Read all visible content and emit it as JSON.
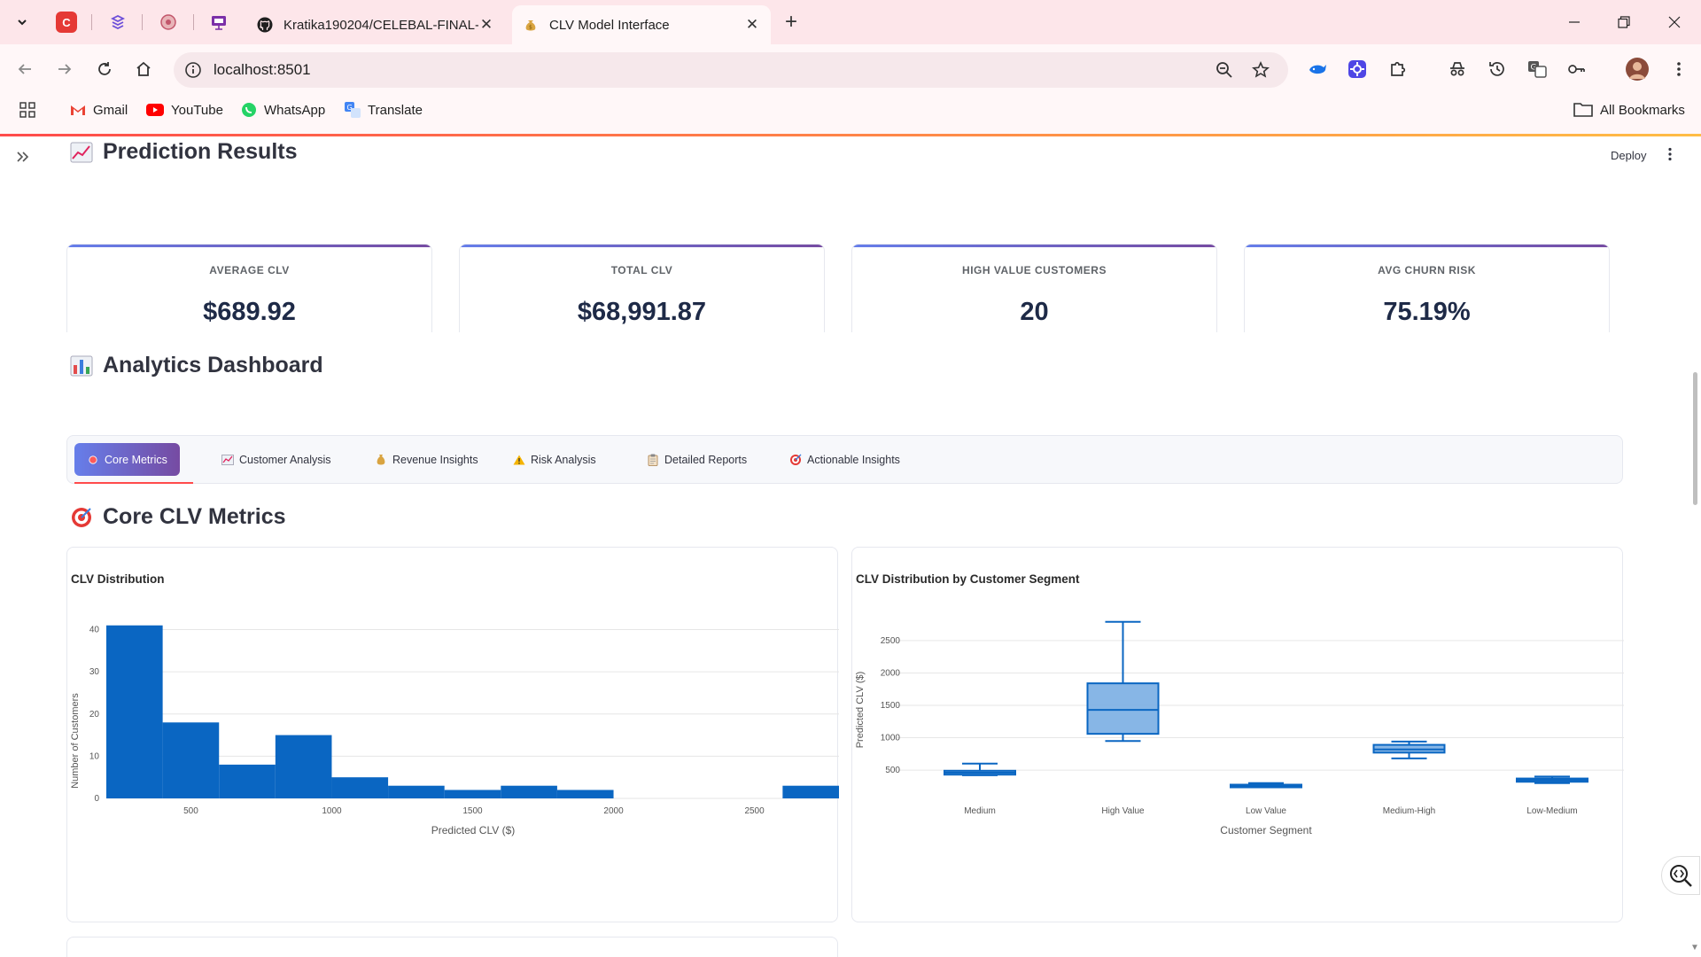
{
  "browser": {
    "tabs": [
      {
        "title": "Kratika190204/CELEBAL-FINAL-",
        "active": false
      },
      {
        "title": "CLV Model Interface",
        "active": true
      }
    ],
    "url": "localhost:8501",
    "bookmarks": [
      "Gmail",
      "YouTube",
      "WhatsApp",
      "Translate"
    ],
    "all_bookmarks": "All Bookmarks"
  },
  "app": {
    "deploy_label": "Deploy",
    "prediction_heading": "Prediction Results",
    "metrics": [
      {
        "label": "AVERAGE CLV",
        "value": "$689.92"
      },
      {
        "label": "TOTAL CLV",
        "value": "$68,991.87"
      },
      {
        "label": "HIGH VALUE CUSTOMERS",
        "value": "20"
      },
      {
        "label": "AVG CHURN RISK",
        "value": "75.19%"
      }
    ],
    "analytics_heading": "Analytics Dashboard",
    "tabs": [
      {
        "label": "Core Metrics",
        "icon": "red-circle-icon"
      },
      {
        "label": "Customer Analysis",
        "icon": "chart-up-icon"
      },
      {
        "label": "Revenue Insights",
        "icon": "money-bag-icon"
      },
      {
        "label": "Risk Analysis",
        "icon": "warning-icon"
      },
      {
        "label": "Detailed Reports",
        "icon": "clipboard-icon"
      },
      {
        "label": "Actionable Insights",
        "icon": "target-icon"
      }
    ],
    "section_heading": "Core CLV Metrics"
  },
  "chart_data": [
    {
      "type": "bar",
      "title": "CLV Distribution",
      "xlabel": "Predicted CLV ($)",
      "ylabel": "Number of Customers",
      "bin_edges": [
        200,
        400,
        600,
        800,
        1000,
        1200,
        1400,
        1600,
        1800,
        2000,
        2200,
        2400,
        2600,
        2800
      ],
      "values": [
        41,
        18,
        8,
        15,
        5,
        3,
        2,
        3,
        2,
        0,
        0,
        0,
        3
      ],
      "xticks": [
        "500",
        "1000",
        "1500",
        "2000",
        "2500"
      ],
      "yticks": [
        "0",
        "10",
        "20",
        "30",
        "40"
      ],
      "color": "#0a66c2"
    },
    {
      "type": "box",
      "title": "CLV Distribution by Customer Segment",
      "xlabel": "Customer Segment",
      "ylabel": "Predicted CLV ($)",
      "categories": [
        "Medium",
        "High Value",
        "Low Value",
        "Medium-High",
        "Low-Medium"
      ],
      "boxes": [
        {
          "min": 420,
          "q1": 430,
          "median": 460,
          "q3": 490,
          "max": 600
        },
        {
          "min": 950,
          "q1": 1060,
          "median": 1430,
          "q3": 1840,
          "max": 2790
        },
        {
          "min": 240,
          "q1": 245,
          "median": 260,
          "q3": 275,
          "max": 300
        },
        {
          "min": 680,
          "q1": 770,
          "median": 820,
          "q3": 890,
          "max": 940
        },
        {
          "min": 300,
          "q1": 320,
          "median": 345,
          "q3": 370,
          "max": 400
        }
      ],
      "yticks": [
        "500",
        "1000",
        "1500",
        "2000",
        "2500"
      ],
      "color": "#0a66c2"
    }
  ]
}
